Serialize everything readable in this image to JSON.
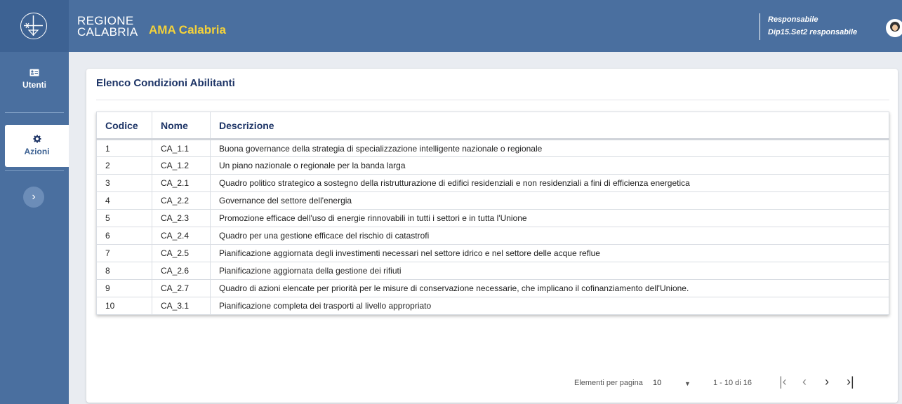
{
  "header": {
    "brand_line1": "REGIONE",
    "brand_line2": "CALABRIA",
    "app_name": "AMA Calabria",
    "user_role": "Responsabile",
    "user_name": "Dip15.Set2 responsabile"
  },
  "sidebar": {
    "items": [
      {
        "label": "Utenti",
        "icon": "id-card-icon"
      },
      {
        "label": "Azioni",
        "icon": "gear-icon"
      }
    ],
    "expand_icon": "chevron-right-icon"
  },
  "page": {
    "title": "Elenco Condizioni Abilitanti"
  },
  "table": {
    "headers": [
      "Codice",
      "Nome",
      "Descrizione"
    ],
    "rows": [
      [
        "1",
        "CA_1.1",
        "Buona governance della strategia di specializzazione intelligente nazionale o regionale"
      ],
      [
        "2",
        "CA_1.2",
        "Un piano nazionale o regionale per la banda larga"
      ],
      [
        "3",
        "CA_2.1",
        "Quadro politico strategico a sostegno della ristrutturazione di edifici residenziali e non residenziali a fini di efficienza energetica"
      ],
      [
        "4",
        "CA_2.2",
        "Governance del settore dell'energia"
      ],
      [
        "5",
        "CA_2.3",
        "Promozione efficace dell'uso di energie rinnovabili in tutti i settori e in tutta l'Unione"
      ],
      [
        "6",
        "CA_2.4",
        "Quadro per una gestione efficace del rischio di catastrofi"
      ],
      [
        "7",
        "CA_2.5",
        "Pianificazione aggiornata degli investimenti necessari nel settore idrico e nel settore delle acque reflue"
      ],
      [
        "8",
        "CA_2.6",
        "Pianificazione aggiornata della gestione dei rifiuti"
      ],
      [
        "9",
        "CA_2.7",
        "Quadro di azioni elencate per priorità per le misure di conservazione necessarie, che implicano il cofinanziamento dell'Unione."
      ],
      [
        "10",
        "CA_3.1",
        "Pianificazione completa dei trasporti al livello appropriato"
      ]
    ]
  },
  "pagination": {
    "label": "Elementi per pagina",
    "page_size": "10",
    "range": "1 - 10 di 16"
  },
  "colors": {
    "header_bg": "#4a6f9f",
    "accent_yellow": "#f4d23a",
    "title_navy": "#1d3466"
  }
}
